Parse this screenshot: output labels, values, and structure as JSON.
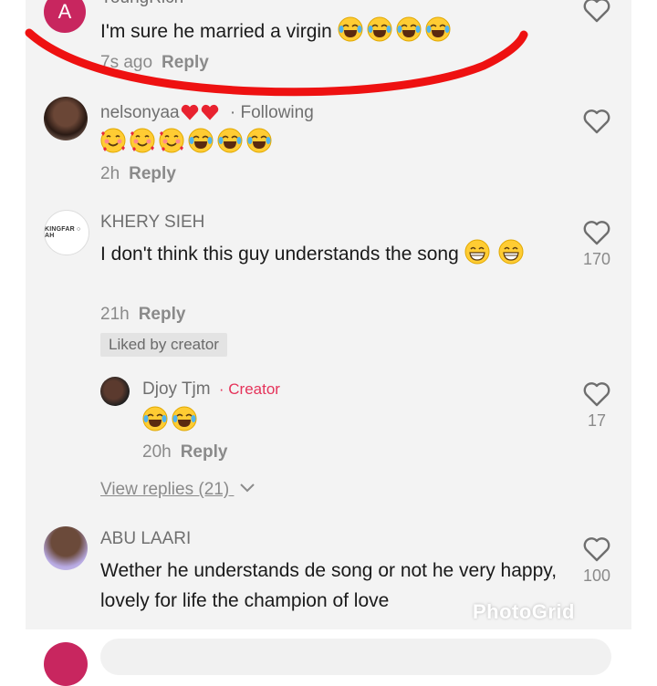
{
  "comments": [
    {
      "username": "YoungRich",
      "avatar_letter": "A",
      "text": "I'm sure he married a virgin",
      "time": "7s ago",
      "reply": "Reply",
      "likes": ""
    },
    {
      "username": "nelsonyaa",
      "following": "· Following",
      "time": "2h",
      "reply": "Reply",
      "likes": ""
    },
    {
      "username": "KHERY SIEH",
      "avatar_text": "KINGFAR ○ AH",
      "text": "I don't think this guy understands the song",
      "time": "21h",
      "reply": "Reply",
      "liked_by_creator": "Liked by creator",
      "likes": "170"
    },
    {
      "username": "Djoy Tjm",
      "creator_label": "· Creator",
      "time": "20h",
      "reply": "Reply",
      "likes": "17"
    },
    {
      "username": "ABU LAARI",
      "text": "Wether he understands de song or not he very happy, lovely for life the champion of love",
      "likes": "100"
    }
  ],
  "view_replies": "View replies (21)",
  "watermark": "PhotoGrid",
  "colors": {
    "panel": "#f3f3f3",
    "accent_red": "#e5335a",
    "annotation_red": "#ee1111",
    "muted": "#8a8a8a"
  },
  "icons": [
    "heart-icon",
    "chevron-down-icon",
    "laughing-emoji",
    "smiling-hearts-emoji",
    "grin-emoji",
    "red-heart-emoji"
  ]
}
